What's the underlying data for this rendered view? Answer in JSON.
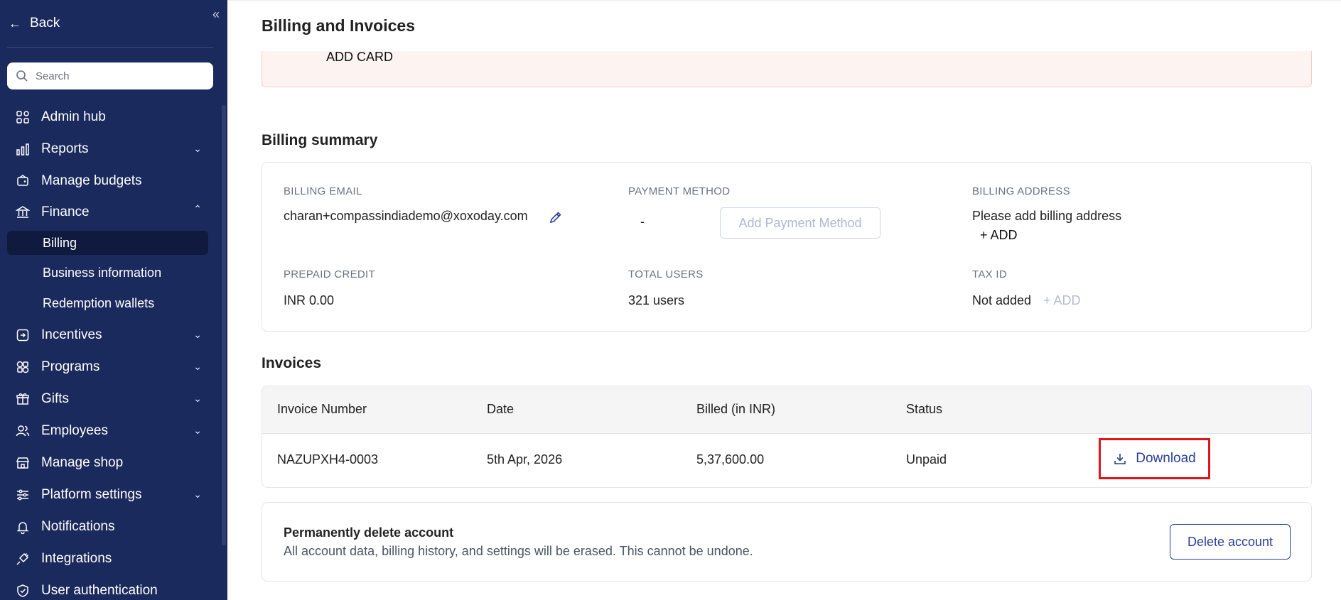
{
  "sidebar": {
    "back_label": "Back",
    "search_placeholder": "Search",
    "items": [
      {
        "label": "Admin hub",
        "icon": "grid-icon"
      },
      {
        "label": "Reports",
        "icon": "chart-icon"
      },
      {
        "label": "Manage budgets",
        "icon": "budget-icon"
      },
      {
        "label": "Finance",
        "icon": "bank-icon"
      },
      {
        "label": "Incentives",
        "icon": "incentive-icon"
      },
      {
        "label": "Programs",
        "icon": "programs-icon"
      },
      {
        "label": "Gifts",
        "icon": "gift-icon"
      },
      {
        "label": "Employees",
        "icon": "users-icon"
      },
      {
        "label": "Manage shop",
        "icon": "shop-icon"
      },
      {
        "label": "Platform settings",
        "icon": "sliders-icon"
      },
      {
        "label": "Notifications",
        "icon": "bell-icon"
      },
      {
        "label": "Integrations",
        "icon": "plug-icon"
      },
      {
        "label": "User authentication",
        "icon": "shield-icon"
      }
    ],
    "finance_sub": [
      "Billing",
      "Business information",
      "Redemption wallets"
    ],
    "active_sub": "Billing"
  },
  "header": {
    "title": "Billing and Invoices"
  },
  "alert": {
    "add_card_label": "ADD CARD"
  },
  "billing_summary": {
    "title": "Billing summary",
    "billing_email_label": "BILLING EMAIL",
    "billing_email": "charan+compassindiademo@xoxoday.com",
    "payment_method_label": "PAYMENT METHOD",
    "payment_method_value": "-",
    "add_payment_method_label": "Add Payment Method",
    "billing_address_label": "BILLING ADDRESS",
    "billing_address_value": "Please add billing address",
    "billing_address_add": "+ ADD",
    "prepaid_credit_label": "PREPAID CREDIT",
    "prepaid_credit_value": "INR 0.00",
    "total_users_label": "TOTAL USERS",
    "total_users_value": "321 users",
    "tax_id_label": "TAX ID",
    "tax_id_value": "Not added",
    "tax_id_add": "+ ADD"
  },
  "invoices": {
    "title": "Invoices",
    "columns": [
      "Invoice Number",
      "Date",
      "Billed (in INR)",
      "Status"
    ],
    "rows": [
      {
        "number": "NAZUPXH4-0003",
        "date": "5th Apr, 2026",
        "billed": "5,37,600.00",
        "status": "Unpaid",
        "action": "Download"
      }
    ]
  },
  "danger": {
    "title": "Permanently delete account",
    "description": "All account data, billing history, and settings will be erased. This cannot be undone.",
    "delete_label": "Delete account"
  },
  "colors": {
    "sidebar_bg": "#1b2a5c",
    "accent": "#2a3f95",
    "highlight": "#e0161f",
    "alert_bg": "#fdf3f1"
  }
}
